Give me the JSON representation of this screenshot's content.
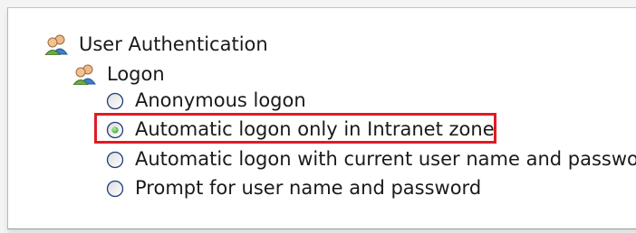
{
  "tree": {
    "parent_label": "User Authentication",
    "group_label": "Logon",
    "options": [
      {
        "label": "Anonymous logon",
        "selected": false
      },
      {
        "label": "Automatic logon only in Intranet zone",
        "selected": true
      },
      {
        "label": "Automatic logon with current user name and passwor",
        "selected": false
      },
      {
        "label": "Prompt for user name and password",
        "selected": false
      }
    ]
  },
  "colors": {
    "highlight_border": "#e01b24",
    "radio_selected_dot": "#2fa836"
  },
  "icons": {
    "group_icon": "users-icon"
  }
}
